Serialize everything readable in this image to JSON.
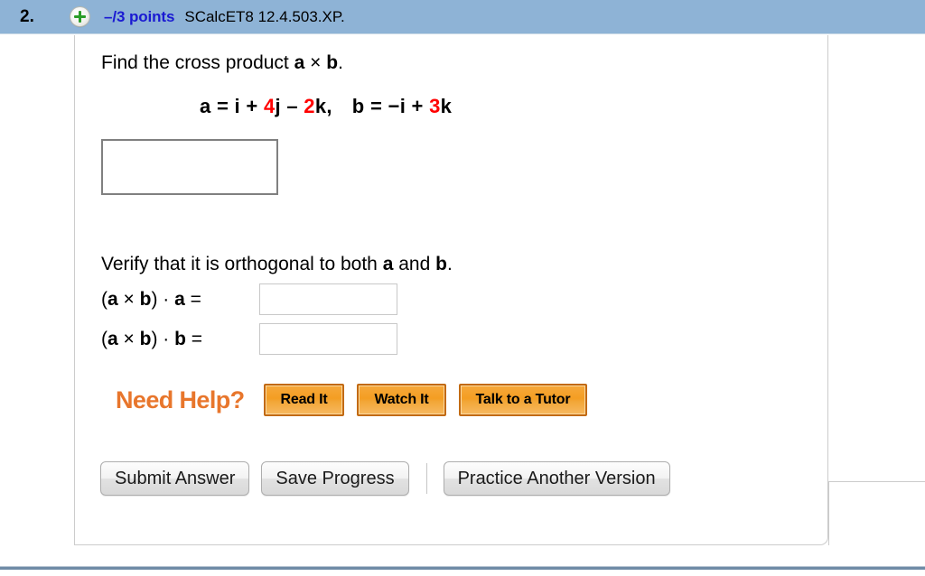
{
  "header": {
    "question_number": "2.",
    "plus_icon": "plus-circle-icon",
    "points": "–/3 points",
    "question_code": "SCalcET8 12.4.503.XP.",
    "background_color": "#8eb3d6",
    "points_color": "#1a1ad2"
  },
  "problem": {
    "prompt_before": "Find the cross product ",
    "prompt_vector_a": "a",
    "prompt_times": " × ",
    "prompt_vector_b": "b",
    "prompt_after": ".",
    "vector_a": {
      "name": "a",
      "equals": " = ",
      "terms": [
        {
          "coef": "",
          "unit": "i",
          "coef_color": "#000000"
        },
        {
          "op": " + ",
          "coef": "4",
          "unit": "j",
          "coef_color": "#ff0000"
        },
        {
          "op": " – ",
          "coef": "2",
          "unit": "k",
          "coef_color": "#ff0000"
        }
      ],
      "trailing": ","
    },
    "vector_b": {
      "name": "b",
      "equals": " = ",
      "terms": [
        {
          "op": "−",
          "coef": "",
          "unit": "i",
          "coef_color": "#000000"
        },
        {
          "op": " + ",
          "coef": "3",
          "unit": "k",
          "coef_color": "#ff0000"
        }
      ],
      "trailing": ""
    },
    "answer_value": "",
    "answer_placeholder": ""
  },
  "verify": {
    "text_before": "Verify that it is orthogonal to both ",
    "vector_a": "a",
    "text_middle": " and ",
    "vector_b": "b",
    "text_after": ".",
    "rows": [
      {
        "label_open": "(",
        "label_a": "a",
        "label_cross": " × ",
        "label_b": "b",
        "label_close": ") · ",
        "label_dotted": "a",
        "label_equals": "  =",
        "value": "",
        "placeholder": ""
      },
      {
        "label_open": "(",
        "label_a": "a",
        "label_cross": " × ",
        "label_b": "b",
        "label_close": ") · ",
        "label_dotted": "b",
        "label_equals": "  =",
        "value": "",
        "placeholder": ""
      }
    ]
  },
  "help": {
    "title": "Need Help?",
    "title_color": "#e8762c",
    "buttons": [
      {
        "label": "Read It"
      },
      {
        "label": "Watch It"
      },
      {
        "label": "Talk to a Tutor"
      }
    ]
  },
  "actions": {
    "submit_label": "Submit Answer",
    "save_label": "Save Progress",
    "practice_label": "Practice Another Version"
  }
}
